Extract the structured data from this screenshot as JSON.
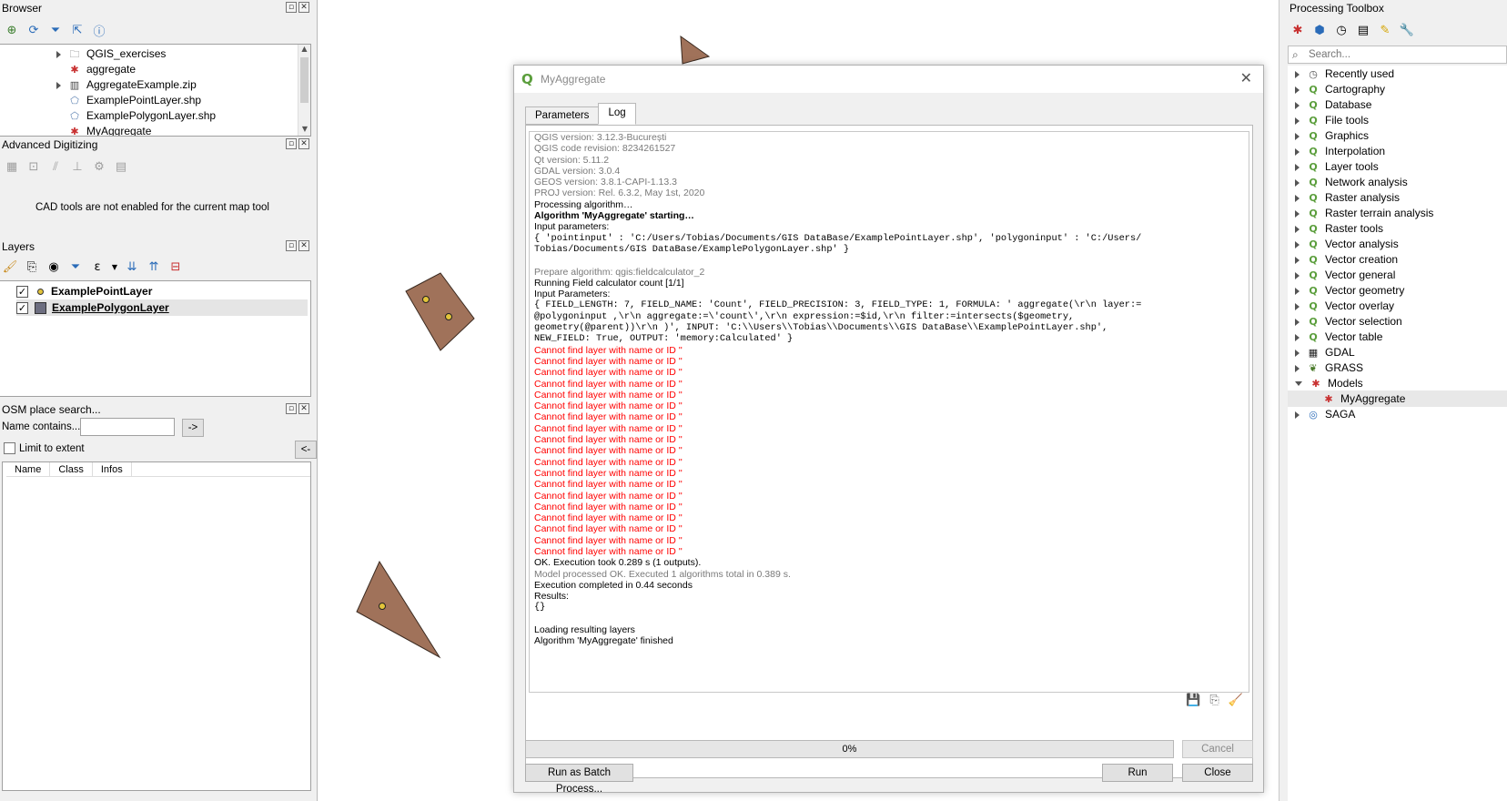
{
  "browser": {
    "title": "Browser",
    "items": [
      {
        "label": "QGIS_exercises",
        "icon": "folder-icon",
        "expandable": true
      },
      {
        "label": "aggregate",
        "icon": "model-icon",
        "expandable": false
      },
      {
        "label": "AggregateExample.zip",
        "icon": "zip-icon",
        "expandable": true
      },
      {
        "label": "ExamplePointLayer.shp",
        "icon": "polygon-layer-icon",
        "expandable": false
      },
      {
        "label": "ExamplePolygonLayer.shp",
        "icon": "polygon-layer-icon",
        "expandable": false
      },
      {
        "label": "MyAggregate",
        "icon": "model-icon",
        "expandable": false
      }
    ]
  },
  "digitizing": {
    "title": "Advanced Digitizing",
    "message": "CAD tools are not enabled for the current map tool"
  },
  "layers": {
    "title": "Layers",
    "items": [
      {
        "label": "ExamplePointLayer",
        "checked": true,
        "symbol": "point"
      },
      {
        "label": "ExamplePolygonLayer",
        "checked": true,
        "symbol": "polygon"
      }
    ]
  },
  "osm": {
    "title": "OSM place search...",
    "name_label": "Name contains...",
    "name_value": "",
    "go_label": "->",
    "limit_label": "Limit to extent",
    "back_label": "<-",
    "columns": [
      "Name",
      "Class",
      "Infos"
    ]
  },
  "dialog": {
    "title": "MyAggregate",
    "tabs": [
      {
        "label": "Parameters",
        "active": false
      },
      {
        "label": "Log",
        "active": true
      }
    ],
    "progress_label": "0%",
    "progress_value": 0,
    "cancel_label": "Cancel",
    "batch_label": "Run as Batch Process...",
    "run_label": "Run",
    "close_label": "Close",
    "log": [
      {
        "text": "QGIS version: 3.12.3-București",
        "style": "gray"
      },
      {
        "text": "QGIS code revision: 8234261527",
        "style": "gray"
      },
      {
        "text": "Qt version: 5.11.2",
        "style": "gray"
      },
      {
        "text": "GDAL version: 3.0.4",
        "style": "gray"
      },
      {
        "text": "GEOS version: 3.8.1-CAPI-1.13.3",
        "style": "gray"
      },
      {
        "text": "PROJ version: Rel. 6.3.2, May 1st, 2020",
        "style": "gray"
      },
      {
        "text": "Processing algorithm…",
        "style": "normal"
      },
      {
        "text": "Algorithm 'MyAggregate' starting…",
        "style": "bold"
      },
      {
        "text": "Input parameters:",
        "style": "normal"
      },
      {
        "text": "{ 'pointinput' : 'C:/Users/Tobias/Documents/GIS DataBase/ExamplePointLayer.shp', 'polygoninput' : 'C:/Users/",
        "style": "mono"
      },
      {
        "text": "Tobias/Documents/GIS DataBase/ExamplePolygonLayer.shp' }",
        "style": "mono"
      },
      {
        "text": "",
        "style": "normal"
      },
      {
        "text": "Prepare algorithm: qgis:fieldcalculator_2",
        "style": "gray"
      },
      {
        "text": "Running Field calculator count [1/1]",
        "style": "normal"
      },
      {
        "text": "Input Parameters:",
        "style": "normal"
      },
      {
        "text": "{ FIELD_LENGTH: 7, FIELD_NAME: 'Count', FIELD_PRECISION: 3, FIELD_TYPE: 1, FORMULA: ' aggregate(\\r\\n layer:=",
        "style": "mono"
      },
      {
        "text": "@polygoninput ,\\r\\n aggregate:=\\'count\\',\\r\\n expression:=$id,\\r\\n filter:=intersects($geometry,",
        "style": "mono"
      },
      {
        "text": "geometry(@parent))\\r\\n )', INPUT: 'C:\\\\Users\\\\Tobias\\\\Documents\\\\GIS DataBase\\\\ExamplePointLayer.shp',",
        "style": "mono"
      },
      {
        "text": "NEW_FIELD: True, OUTPUT: 'memory:Calculated' }",
        "style": "mono"
      },
      {
        "text": "Cannot find layer with name or ID ''",
        "style": "red"
      },
      {
        "text": "Cannot find layer with name or ID ''",
        "style": "red"
      },
      {
        "text": "Cannot find layer with name or ID ''",
        "style": "red"
      },
      {
        "text": "Cannot find layer with name or ID ''",
        "style": "red"
      },
      {
        "text": "Cannot find layer with name or ID ''",
        "style": "red"
      },
      {
        "text": "Cannot find layer with name or ID ''",
        "style": "red"
      },
      {
        "text": "Cannot find layer with name or ID ''",
        "style": "red"
      },
      {
        "text": "Cannot find layer with name or ID ''",
        "style": "red"
      },
      {
        "text": "Cannot find layer with name or ID ''",
        "style": "red"
      },
      {
        "text": "Cannot find layer with name or ID ''",
        "style": "red"
      },
      {
        "text": "Cannot find layer with name or ID ''",
        "style": "red"
      },
      {
        "text": "Cannot find layer with name or ID ''",
        "style": "red"
      },
      {
        "text": "Cannot find layer with name or ID ''",
        "style": "red"
      },
      {
        "text": "Cannot find layer with name or ID ''",
        "style": "red"
      },
      {
        "text": "Cannot find layer with name or ID ''",
        "style": "red"
      },
      {
        "text": "Cannot find layer with name or ID ''",
        "style": "red"
      },
      {
        "text": "Cannot find layer with name or ID ''",
        "style": "red"
      },
      {
        "text": "Cannot find layer with name or ID ''",
        "style": "red"
      },
      {
        "text": "Cannot find layer with name or ID ''",
        "style": "red"
      },
      {
        "text": "OK. Execution took 0.289 s (1 outputs).",
        "style": "normal"
      },
      {
        "text": "Model processed OK. Executed 1 algorithms total in 0.389 s.",
        "style": "gray"
      },
      {
        "text": "Execution completed in 0.44 seconds",
        "style": "normal"
      },
      {
        "text": "Results:",
        "style": "normal"
      },
      {
        "text": "{}",
        "style": "mono"
      },
      {
        "text": "",
        "style": "normal"
      },
      {
        "text": "Loading resulting layers",
        "style": "normal"
      },
      {
        "text": "Algorithm 'MyAggregate' finished",
        "style": "normal"
      }
    ]
  },
  "toolbox": {
    "title": "Processing Toolbox",
    "search_placeholder": "Search...",
    "items": [
      {
        "label": "Recently used",
        "icon": "clock-icon",
        "state": "collapsed",
        "indent": 0
      },
      {
        "label": "Cartography",
        "icon": "qgis-icon",
        "state": "collapsed",
        "indent": 0
      },
      {
        "label": "Database",
        "icon": "qgis-icon",
        "state": "collapsed",
        "indent": 0
      },
      {
        "label": "File tools",
        "icon": "qgis-icon",
        "state": "collapsed",
        "indent": 0
      },
      {
        "label": "Graphics",
        "icon": "qgis-icon",
        "state": "collapsed",
        "indent": 0
      },
      {
        "label": "Interpolation",
        "icon": "qgis-icon",
        "state": "collapsed",
        "indent": 0
      },
      {
        "label": "Layer tools",
        "icon": "qgis-icon",
        "state": "collapsed",
        "indent": 0
      },
      {
        "label": "Network analysis",
        "icon": "qgis-icon",
        "state": "collapsed",
        "indent": 0
      },
      {
        "label": "Raster analysis",
        "icon": "qgis-icon",
        "state": "collapsed",
        "indent": 0
      },
      {
        "label": "Raster terrain analysis",
        "icon": "qgis-icon",
        "state": "collapsed",
        "indent": 0
      },
      {
        "label": "Raster tools",
        "icon": "qgis-icon",
        "state": "collapsed",
        "indent": 0
      },
      {
        "label": "Vector analysis",
        "icon": "qgis-icon",
        "state": "collapsed",
        "indent": 0
      },
      {
        "label": "Vector creation",
        "icon": "qgis-icon",
        "state": "collapsed",
        "indent": 0
      },
      {
        "label": "Vector general",
        "icon": "qgis-icon",
        "state": "collapsed",
        "indent": 0
      },
      {
        "label": "Vector geometry",
        "icon": "qgis-icon",
        "state": "collapsed",
        "indent": 0
      },
      {
        "label": "Vector overlay",
        "icon": "qgis-icon",
        "state": "collapsed",
        "indent": 0
      },
      {
        "label": "Vector selection",
        "icon": "qgis-icon",
        "state": "collapsed",
        "indent": 0
      },
      {
        "label": "Vector table",
        "icon": "qgis-icon",
        "state": "collapsed",
        "indent": 0
      },
      {
        "label": "GDAL",
        "icon": "gdal-icon",
        "state": "collapsed",
        "indent": 0
      },
      {
        "label": "GRASS",
        "icon": "grass-icon",
        "state": "collapsed",
        "indent": 0
      },
      {
        "label": "Models",
        "icon": "models-icon",
        "state": "expanded",
        "indent": 0
      },
      {
        "label": "MyAggregate",
        "icon": "model-icon",
        "state": "leaf",
        "indent": 1
      },
      {
        "label": "SAGA",
        "icon": "saga-icon",
        "state": "collapsed",
        "indent": 0
      }
    ]
  },
  "colors": {
    "feature_fill": "#a0725a",
    "feature_stroke": "#3a2a20",
    "point_fill": "#e3c43a",
    "qgis_green": "#5b9e3c",
    "error_red": "#ff0000"
  }
}
